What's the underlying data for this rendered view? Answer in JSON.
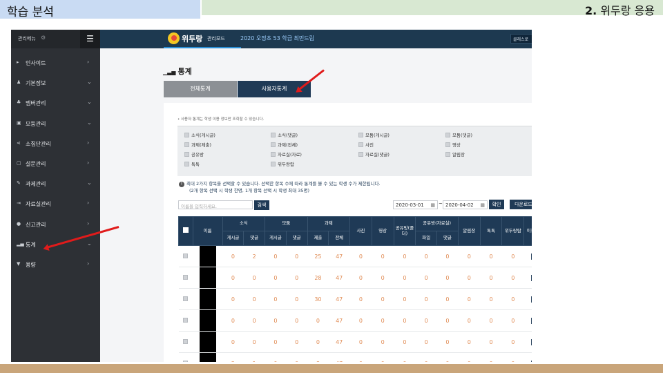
{
  "slide": {
    "left_title": "학습 분석",
    "right_number": "2.",
    "right_title": "위두랑 응용"
  },
  "sidebar": {
    "header": "관리메뉴",
    "items": [
      {
        "label": "인사이트",
        "icon": "home-icon",
        "chevron": "›"
      },
      {
        "label": "기본정보",
        "icon": "user-icon",
        "chevron": "⌄"
      },
      {
        "label": "멤버관리",
        "icon": "members-icon",
        "chevron": "⌄"
      },
      {
        "label": "모둠관리",
        "icon": "group-icon",
        "chevron": "⌄"
      },
      {
        "label": "소집단관리",
        "icon": "share-icon",
        "chevron": "›"
      },
      {
        "label": "설문관리",
        "icon": "survey-icon",
        "chevron": "›"
      },
      {
        "label": "과제관리",
        "icon": "pencil-icon",
        "chevron": "⌄"
      },
      {
        "label": "자료실관리",
        "icon": "folder-icon",
        "chevron": "›"
      },
      {
        "label": "신고관리",
        "icon": "alert-icon",
        "chevron": "›"
      },
      {
        "label": "통계",
        "icon": "bar-chart-icon",
        "chevron": "⌄"
      },
      {
        "label": "용량",
        "icon": "cart-icon",
        "chevron": "›"
      }
    ]
  },
  "topbar": {
    "logo": "위두랑",
    "mode": "관리모드",
    "class_name": "2020 오정초 53 학급 최민드림",
    "class_button": "클래스로"
  },
  "page": {
    "title": "통계",
    "tab_all": "전체통계",
    "tab_user": "사용자통계",
    "note": "• 사용자 통계는 학생 이용 정보만 조회할 수 있습니다.",
    "warning_line1": "최대 2가지 항목을 선택할 수 있습니다. 선택한 항목 수에 따라 통계를 볼 수 있는 학생 수가 제한됩니다.",
    "warning_line2": "(2개 항목 선택 시 학생 한명, 1개 항목 선택 시 학생 최대 35명)",
    "search_placeholder": "이름을 입력하세요.",
    "search_button": "검색",
    "date_from": "2020-03-01",
    "date_to": "2020-04-02",
    "tilde": "~",
    "confirm_button": "확인",
    "download_button": "다운로드"
  },
  "filters": [
    [
      "소식(게시글)",
      "소식(댓글)",
      "모둠(게시글)",
      "모둠(댓글)"
    ],
    [
      "과제(제출)",
      "과제(전체)",
      "사진",
      "영상"
    ],
    [
      "공유방",
      "자료실(자료)",
      "자료실(댓글)",
      "알림장"
    ],
    [
      "톡톡",
      "위두랑랍"
    ]
  ],
  "table": {
    "group_headers": {
      "name": "이름",
      "news": "소식",
      "group": "모둠",
      "task": "과제",
      "photo": "사진",
      "video": "영상",
      "share": "공유방(폴더)",
      "library": "공유방(자료실)",
      "notice": "알림장",
      "talk": "톡톡",
      "lab": "위두랑랍",
      "time": "이용시간"
    },
    "sub_headers": [
      "게시글",
      "댓글",
      "게시글",
      "댓글",
      "제출",
      "전체",
      "파일",
      "댓글"
    ],
    "rows": [
      [
        0,
        2,
        0,
        0,
        25,
        47,
        0,
        0,
        0,
        0,
        0,
        0,
        0,
        0
      ],
      [
        0,
        0,
        0,
        0,
        28,
        47,
        0,
        0,
        0,
        0,
        0,
        0,
        0,
        0
      ],
      [
        0,
        0,
        0,
        0,
        30,
        47,
        0,
        0,
        0,
        0,
        0,
        0,
        0,
        0
      ],
      [
        0,
        0,
        0,
        0,
        0,
        47,
        0,
        0,
        0,
        0,
        0,
        0,
        0,
        0
      ],
      [
        0,
        0,
        0,
        0,
        0,
        47,
        0,
        0,
        0,
        0,
        0,
        0,
        0,
        0
      ],
      [
        2,
        1,
        0,
        0,
        8,
        47,
        0,
        0,
        0,
        0,
        0,
        0,
        0,
        0
      ]
    ]
  },
  "colors": {
    "navy": "#1f3a56",
    "sidebar": "#2d3035",
    "value": "#e08a52",
    "arrow": "#e01b1b"
  }
}
